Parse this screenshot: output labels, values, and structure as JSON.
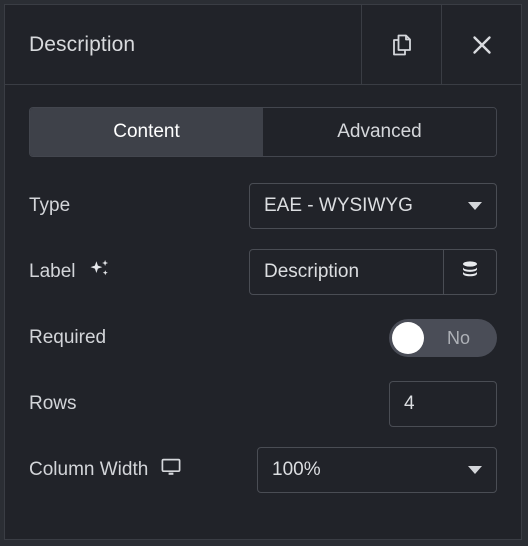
{
  "header": {
    "title": "Description",
    "duplicate_icon": "copy-icon",
    "close_icon": "close-icon"
  },
  "tabs": [
    {
      "label": "Content",
      "active": true
    },
    {
      "label": "Advanced",
      "active": false
    }
  ],
  "fields": {
    "type": {
      "label": "Type",
      "value": "EAE - WYSIWYG",
      "caret_icon": "chevron-down-icon"
    },
    "label": {
      "label": "Label",
      "sparkle_icon": "sparkle-icon",
      "value": "Description",
      "placeholder": "Label",
      "addon_icon": "database-icon"
    },
    "required": {
      "label": "Required",
      "value": "No",
      "checked": false
    },
    "rows": {
      "label": "Rows",
      "value": "4"
    },
    "column_width": {
      "label": "Column Width",
      "device_icon": "desktop-icon",
      "value": "100%",
      "caret_icon": "chevron-down-icon"
    }
  },
  "colors": {
    "panel_bg": "#212329",
    "page_bg": "#2b2e34",
    "border": "#3a3d44",
    "control_border": "#4a4d54",
    "tab_active_bg": "#3e4149",
    "text": "#d3d5d9",
    "toggle_track": "#4a4d57",
    "toggle_knob": "#ffffff"
  }
}
